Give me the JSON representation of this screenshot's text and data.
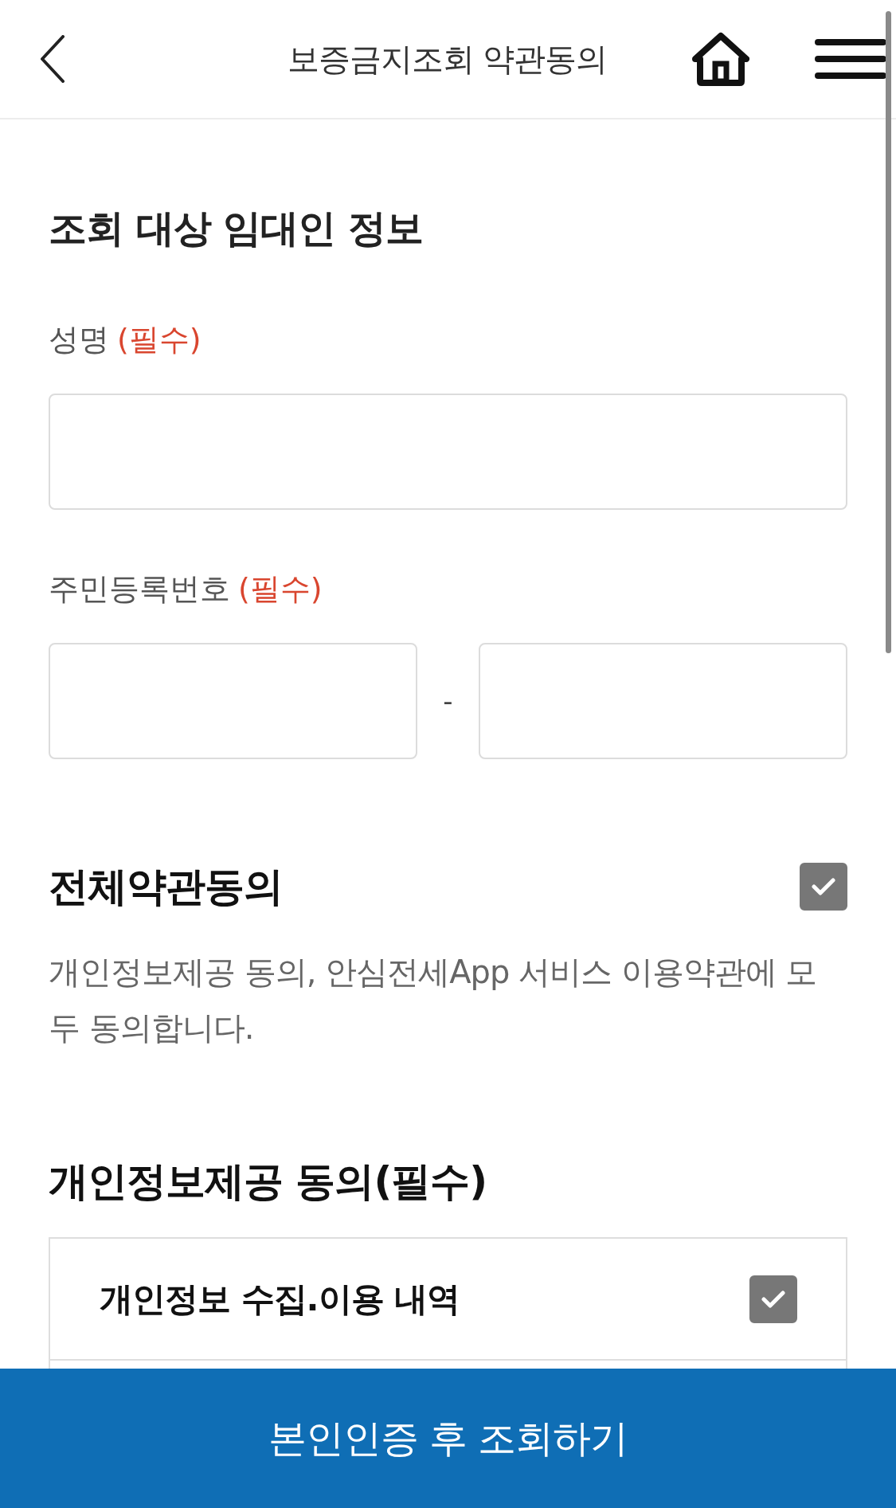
{
  "header": {
    "title": "보증금지조회 약관동의"
  },
  "landlord_section": {
    "title": "조회 대상 임대인 정보",
    "fields": [
      {
        "kind": "single",
        "label": "성명",
        "required_tag": "(필수)"
      },
      {
        "kind": "split",
        "label": "주민등록번호",
        "required_tag": "(필수)",
        "separator": "-"
      }
    ]
  },
  "agree_all": {
    "title": "전체약관동의",
    "checked": true,
    "description": "개인정보제공 동의, 안심전세App 서비스 이용약관에 모두 동의합니다."
  },
  "privacy_section": {
    "title": "개인정보제공 동의(필수)",
    "items": [
      {
        "label": "개인정보 수집.이용 내역",
        "checked": true
      }
    ]
  },
  "bottom_button": {
    "label": "본인인증 후 조회하기"
  }
}
